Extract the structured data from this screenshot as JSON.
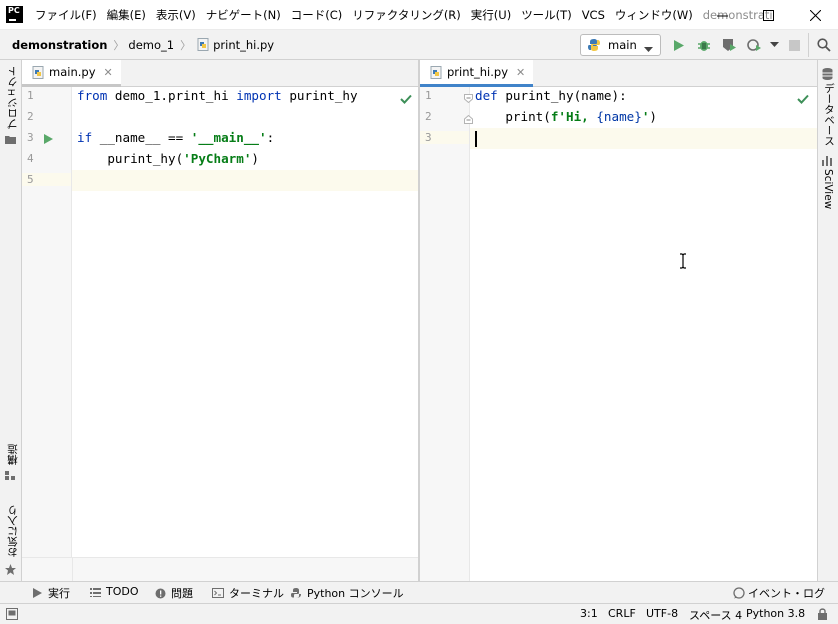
{
  "titlebar": {
    "logo": "PC",
    "menu": [
      "ファイル(F)",
      "編集(E)",
      "表示(V)",
      "ナビゲート(N)",
      "コード(C)",
      "リファクタリング(R)",
      "実行(U)",
      "ツール(T)",
      "VCS",
      "ウィンドウ(W)"
    ],
    "window_title": "demonstratio"
  },
  "breadcrumbs": [
    "demonstration",
    "demo_1",
    "print_hi.py"
  ],
  "run_config": "main",
  "left_stripe": {
    "project": "プロジェクト",
    "structure": "構造",
    "favorites": "お気に入り"
  },
  "right_stripe": {
    "database": "データベース",
    "sciview": "SciView"
  },
  "left_editor": {
    "tab": "main.py",
    "line_numbers": [
      "1",
      "2",
      "3",
      "4",
      "5"
    ],
    "lines": {
      "l1a": "from",
      "l1b": " demo_1.print_hi ",
      "l1c": "import",
      "l1d": " purint_hy",
      "l3a": "if",
      "l3b": " __name__ == ",
      "l3c": "'__main__'",
      "l3d": ":",
      "l4a": "    purint_hy(",
      "l4b": "'PyCharm'",
      "l4c": ")"
    }
  },
  "right_editor": {
    "tab": "print_hi.py",
    "line_numbers": [
      "1",
      "2",
      "3"
    ],
    "lines": {
      "l1a": "def",
      "l1b": " purint_hy(name):",
      "l2a": "    print(",
      "l2b": "f'Hi, ",
      "l2c": "{name}",
      "l2d": "'",
      "l2e": ")"
    }
  },
  "bottom_tools": {
    "run": "実行",
    "todo": "TODO",
    "problems": "問題",
    "terminal": "ターミナル",
    "console": "Python コンソール",
    "event_log": "イベント・ログ"
  },
  "status": {
    "position": "3:1",
    "line_sep": "CRLF",
    "encoding": "UTF-8",
    "indent": "スペース 4",
    "interpreter": "Python 3.8"
  },
  "colors": {
    "keyword": "#0033b3",
    "string": "#067d17",
    "run_green": "#59a869",
    "check_green": "#3d8f58"
  }
}
